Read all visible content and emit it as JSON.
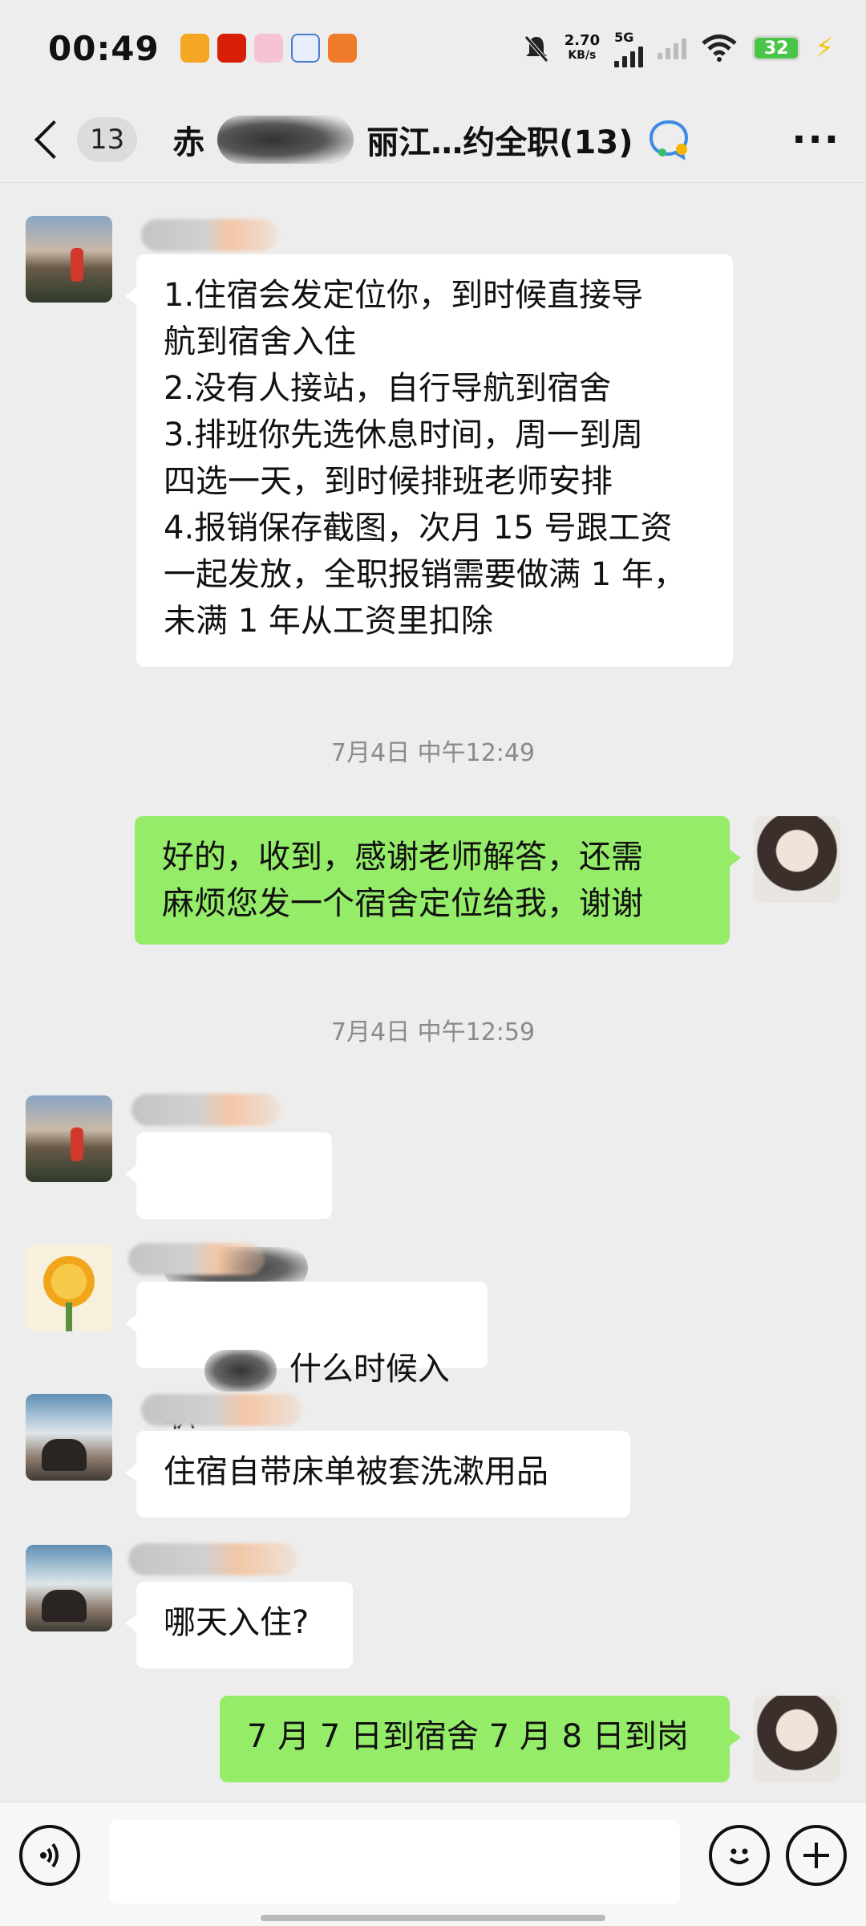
{
  "status_bar": {
    "time": "00:49",
    "net_speed_value": "2.70",
    "net_speed_unit": "KB/s",
    "network_type": "5G",
    "battery_level": "32",
    "app_icons": [
      "weibo-icon",
      "news-app-icon",
      "flower-app-icon",
      "blue-app-icon",
      "orange-app-icon"
    ]
  },
  "header": {
    "unread_count": "13",
    "title_prefix": "赤",
    "title_suffix": "丽江…约全职(13)"
  },
  "messages": [
    {
      "side": "left",
      "text": "1.住宿会发定位你，到时候直接导\n航到宿舍入住\n2.没有人接站，自行导航到宿舍\n3.排班你先选休息时间，周一到周\n四选一天，到时候排班老师安排\n4.报销保存截图，次月 15 号跟工资\n一起发放，全职报销需要做满 1 年，\n未满 1 年从工资里扣除"
    },
    {
      "timestamp": "7月4日 中午12:49"
    },
    {
      "side": "right",
      "text": "好的，收到，感谢老师解答，还需\n麻烦您发一个宿舍定位给我，谢谢"
    },
    {
      "timestamp": "7月4日 中午12:59"
    },
    {
      "side": "left",
      "text": ""
    },
    {
      "side": "left",
      "text": "什么时候入职"
    },
    {
      "side": "left",
      "text": "住宿自带床单被套洗漱用品"
    },
    {
      "side": "left",
      "text": "哪天入住?"
    },
    {
      "side": "right",
      "text": "7 月 7 日到宿舍 7 月 8 日到岗"
    }
  ],
  "colors": {
    "background": "#ededed",
    "own_bubble": "#95ec69",
    "other_bubble": "#ffffff",
    "battery": "#4cc44a"
  }
}
